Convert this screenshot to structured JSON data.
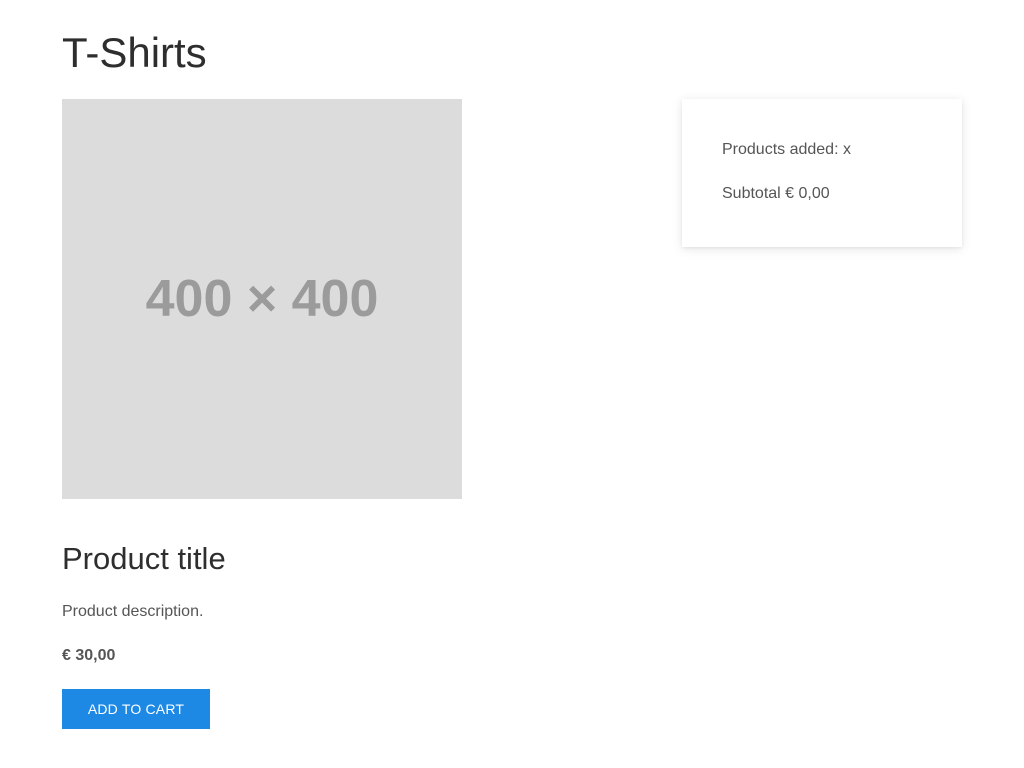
{
  "page": {
    "title": "T-Shirts"
  },
  "product": {
    "image_placeholder": "400 × 400",
    "title": "Product title",
    "description": "Product description.",
    "price": "€ 30,00",
    "add_to_cart_label": "ADD TO CART"
  },
  "cart": {
    "products_added_label": "Products added:",
    "products_added_value": "x",
    "subtotal_label": "Subtotal",
    "subtotal_value": "€ 0,00"
  },
  "colors": {
    "accent": "#1e88e5",
    "image_placeholder_bg": "#dcdcdc",
    "image_placeholder_text": "#9b9b9b"
  }
}
